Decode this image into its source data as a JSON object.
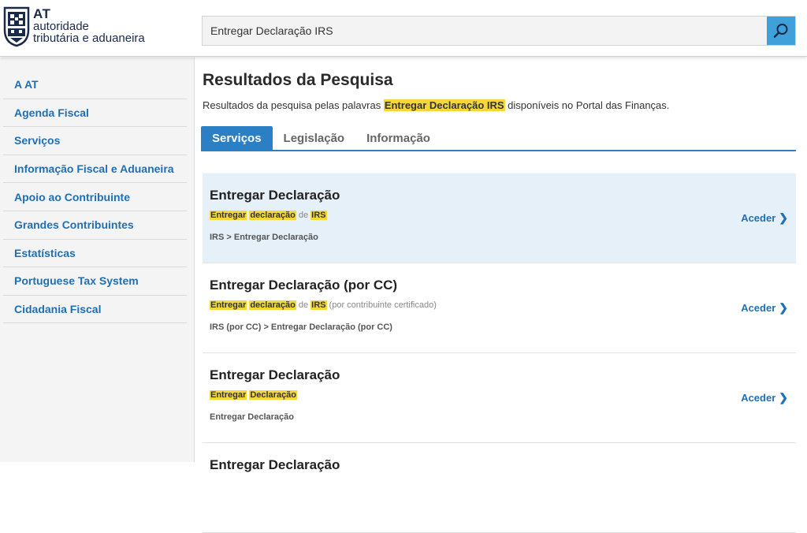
{
  "header": {
    "logo": {
      "at": "AT",
      "line1": "autoridade",
      "line2": "tributária e aduaneira"
    },
    "search": {
      "value": "Entregar Declaração IRS"
    }
  },
  "sidebar": {
    "items": [
      {
        "label": "A AT"
      },
      {
        "label": "Agenda Fiscal"
      },
      {
        "label": "Serviços"
      },
      {
        "label": "Informação Fiscal e Aduaneira"
      },
      {
        "label": "Apoio ao Contribuinte"
      },
      {
        "label": "Grandes Contribuintes"
      },
      {
        "label": "Estatísticas"
      },
      {
        "label": "Portuguese Tax System"
      },
      {
        "label": "Cidadania Fiscal"
      }
    ]
  },
  "main": {
    "title": "Resultados da Pesquisa",
    "subtitle_pre": "Resultados da pesquisa pelas palavras ",
    "subtitle_hl": "Entregar Declaração IRS",
    "subtitle_post": " disponíveis no Portal das Finanças.",
    "tabs": [
      {
        "label": "Serviços",
        "active": true
      },
      {
        "label": "Legislação",
        "active": false
      },
      {
        "label": "Informação",
        "active": false
      }
    ],
    "results": [
      {
        "title": "Entregar Declaração",
        "desc": {
          "hl1": "Entregar",
          "sp": " ",
          "hl2": "declaração",
          "mid": " de ",
          "hl3": "IRS",
          "tail": ""
        },
        "path": "IRS > Entregar Declaração",
        "action": "Aceder"
      },
      {
        "title": "Entregar Declaração (por CC)",
        "desc": {
          "hl1": "Entregar",
          "sp": " ",
          "hl2": "declaração",
          "mid": " de ",
          "hl3": "IRS",
          "tail": " (por contribuinte certificado)"
        },
        "path": "IRS (por CC) > Entregar Declaração (por CC)",
        "action": "Aceder"
      },
      {
        "title": "Entregar Declaração",
        "desc": {
          "hl1": "Entregar",
          "sp": " ",
          "hl2": "Declaração",
          "mid": "",
          "hl3": "",
          "tail": ""
        },
        "path": "Entregar Declaração",
        "action": "Aceder"
      },
      {
        "title": "Entregar Declaração",
        "desc": {
          "hl1": "",
          "sp": "",
          "hl2": "",
          "mid": "",
          "hl3": "",
          "tail": ""
        },
        "path": "",
        "action": ""
      }
    ]
  },
  "colors": {
    "accent": "#2b7fc4",
    "search_button": "#3fa0da",
    "highlight": "#f4d83a",
    "link": "#1f6fb5",
    "selected_row": "#e6f0f8"
  }
}
